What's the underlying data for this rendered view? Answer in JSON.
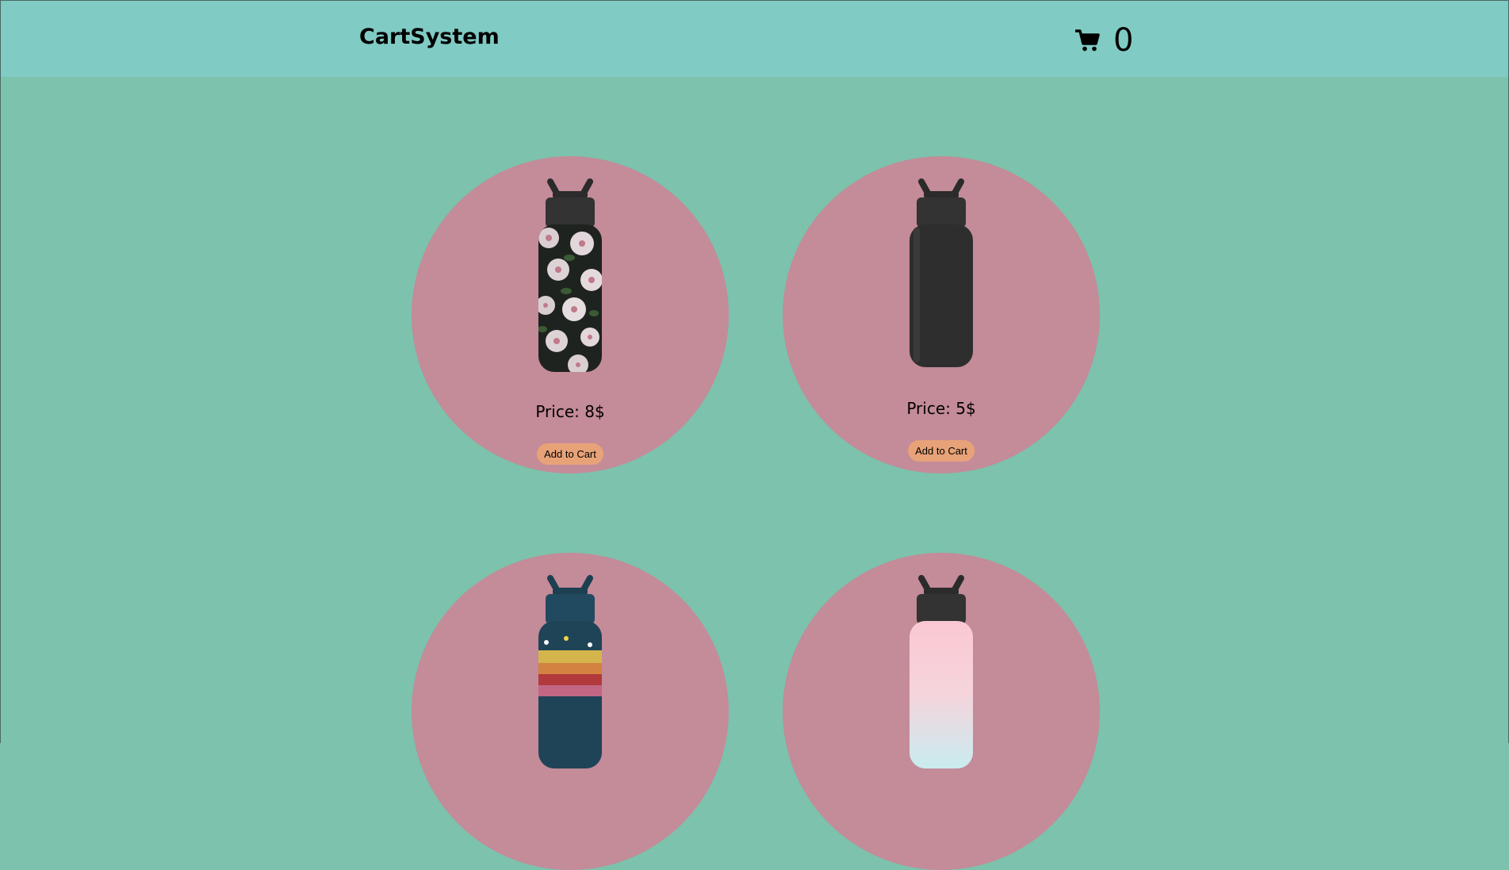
{
  "header": {
    "brand": "CartSystem",
    "cart_icon": "shopping-cart-icon",
    "cart_count": "0"
  },
  "products": [
    {
      "price_label": "Price: 8$",
      "button_label": "Add to Cart",
      "bottle_style": "black-floral"
    },
    {
      "price_label": "Price: 5$",
      "button_label": "Add to Cart",
      "bottle_style": "solid-black"
    },
    {
      "bottle_style": "navy-confetti"
    },
    {
      "bottle_style": "pink-blue-gradient"
    }
  ],
  "colors": {
    "page_bg": "#7cc2ac",
    "navbar_bg": "#80cbc4",
    "card_bg": "#c48b99",
    "button_bg": "#e8a278"
  }
}
